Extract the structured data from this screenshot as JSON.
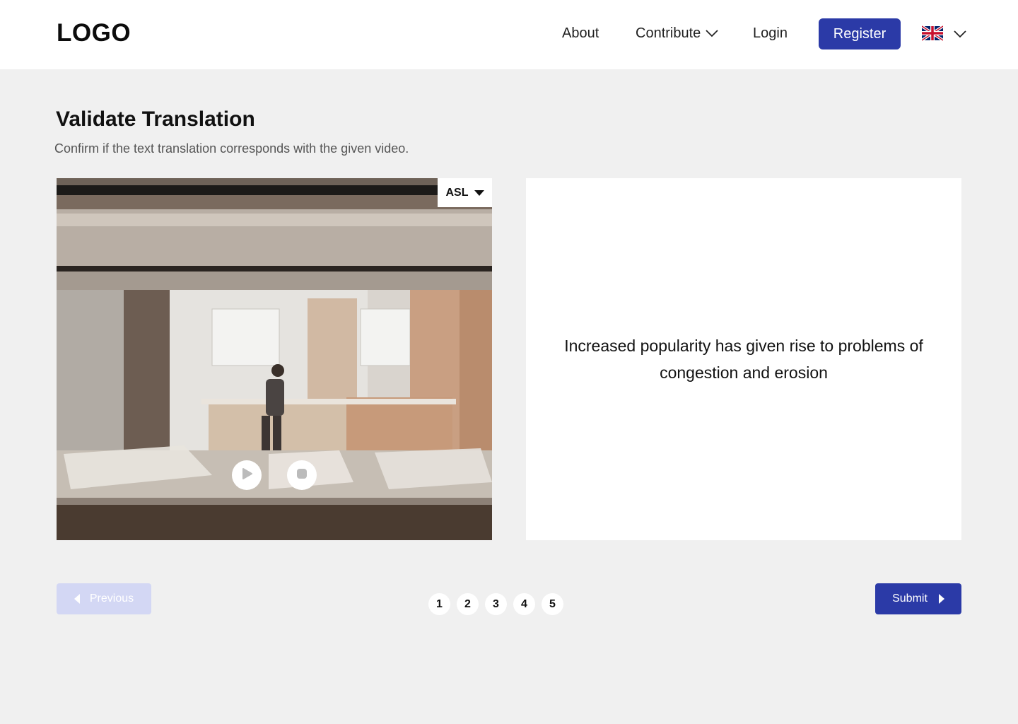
{
  "header": {
    "logo": "LOGO",
    "nav": {
      "about": "About",
      "contribute": "Contribute",
      "login": "Login"
    },
    "register_label": "Register",
    "language_flag": "uk-flag-icon"
  },
  "page": {
    "title": "Validate Translation",
    "subtitle": "Confirm if the text translation corresponds with the given video."
  },
  "video": {
    "sign_language": "ASL"
  },
  "translation": {
    "text": "Increased popularity has given rise to problems of congestion and erosion"
  },
  "controls": {
    "previous_label": "Previous",
    "submit_label": "Submit",
    "pages": [
      "1",
      "2",
      "3",
      "4",
      "5"
    ]
  },
  "colors": {
    "accent": "#2b3aa7",
    "disabled": "#d3d7f4",
    "background": "#f0f0f0"
  }
}
